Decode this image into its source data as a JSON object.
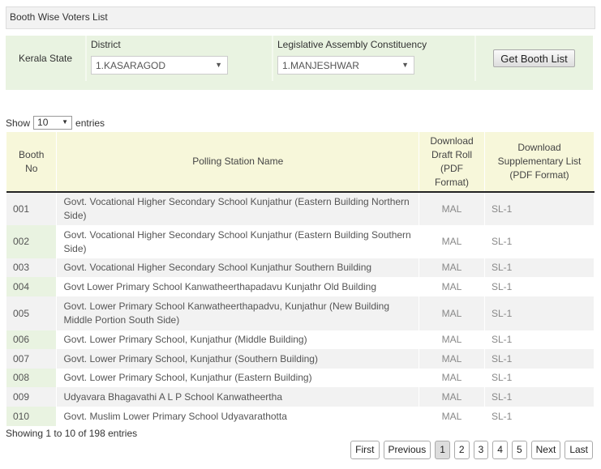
{
  "title": "Booth Wise Voters List",
  "filter": {
    "state": "Kerala State",
    "district_label": "District",
    "district_value": "1.KASARAGOD",
    "lac_label": "Legislative Assembly Constituency",
    "lac_value": "1.MANJESHWAR",
    "button": "Get Booth List"
  },
  "length": {
    "show": "Show",
    "value": "10",
    "entries": "entries"
  },
  "columns": [
    "Booth No",
    "Polling Station Name",
    "Download Draft Roll (PDF Format)",
    "Download Supplementary List (PDF Format)"
  ],
  "rows": [
    {
      "no": "001",
      "name": "Govt. Vocational Higher Secondary School Kunjathur (Eastern Building Northern Side)",
      "draft": "MAL",
      "supp": "SL-1"
    },
    {
      "no": "002",
      "name": "Govt. Vocational Higher Secondary School Kunjathur (Eastern Building Southern Side)",
      "draft": "MAL",
      "supp": "SL-1"
    },
    {
      "no": "003",
      "name": "Govt. Vocational Higher Secondary School Kunjathur Southern Building",
      "draft": "MAL",
      "supp": "SL-1"
    },
    {
      "no": "004",
      "name": "Govt Lower Primary School Kanwatheerthapadavu Kunjathr Old Building",
      "draft": "MAL",
      "supp": "SL-1"
    },
    {
      "no": "005",
      "name": "Govt. Lower Primary School Kanwatheerthapadvu, Kunjathur (New Building Middle Portion South Side)",
      "draft": "MAL",
      "supp": "SL-1"
    },
    {
      "no": "006",
      "name": "Govt. Lower Primary School, Kunjathur (Middle Building)",
      "draft": "MAL",
      "supp": "SL-1"
    },
    {
      "no": "007",
      "name": "Govt. Lower Primary School, Kunjathur (Southern Building)",
      "draft": "MAL",
      "supp": "SL-1"
    },
    {
      "no": "008",
      "name": "Govt. Lower Primary School, Kunjathur (Eastern Building)",
      "draft": "MAL",
      "supp": "SL-1"
    },
    {
      "no": "009",
      "name": "Udyavara Bhagavathi A L P School Kanwatheertha",
      "draft": "MAL",
      "supp": "SL-1"
    },
    {
      "no": "010",
      "name": "Govt. Muslim Lower Primary School Udyavarathotta",
      "draft": "MAL",
      "supp": "SL-1"
    }
  ],
  "info": "Showing 1 to 10 of 198 entries",
  "pager": {
    "first": "First",
    "previous": "Previous",
    "pages": [
      "1",
      "2",
      "3",
      "4",
      "5"
    ],
    "current": "1",
    "next": "Next",
    "last": "Last"
  }
}
